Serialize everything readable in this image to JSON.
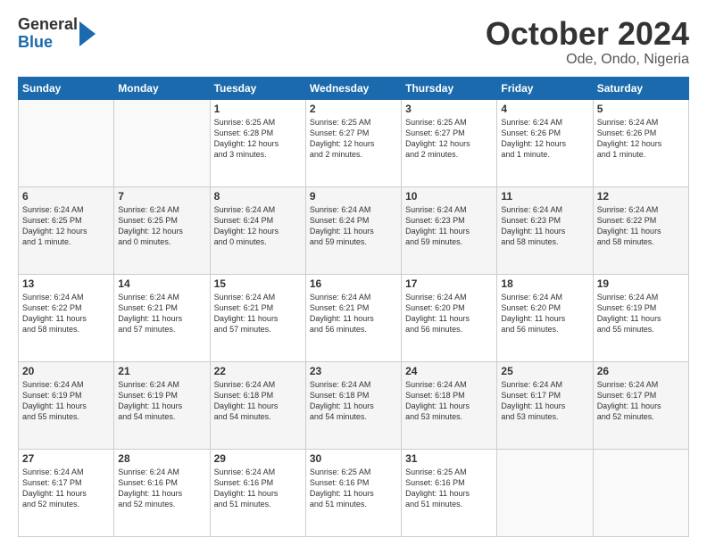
{
  "header": {
    "logo": {
      "general": "General",
      "blue": "Blue"
    },
    "title": "October 2024",
    "location": "Ode, Ondo, Nigeria"
  },
  "weekdays": [
    "Sunday",
    "Monday",
    "Tuesday",
    "Wednesday",
    "Thursday",
    "Friday",
    "Saturday"
  ],
  "weeks": [
    [
      {
        "day": "",
        "info": ""
      },
      {
        "day": "",
        "info": ""
      },
      {
        "day": "1",
        "info": "Sunrise: 6:25 AM\nSunset: 6:28 PM\nDaylight: 12 hours\nand 3 minutes."
      },
      {
        "day": "2",
        "info": "Sunrise: 6:25 AM\nSunset: 6:27 PM\nDaylight: 12 hours\nand 2 minutes."
      },
      {
        "day": "3",
        "info": "Sunrise: 6:25 AM\nSunset: 6:27 PM\nDaylight: 12 hours\nand 2 minutes."
      },
      {
        "day": "4",
        "info": "Sunrise: 6:24 AM\nSunset: 6:26 PM\nDaylight: 12 hours\nand 1 minute."
      },
      {
        "day": "5",
        "info": "Sunrise: 6:24 AM\nSunset: 6:26 PM\nDaylight: 12 hours\nand 1 minute."
      }
    ],
    [
      {
        "day": "6",
        "info": "Sunrise: 6:24 AM\nSunset: 6:25 PM\nDaylight: 12 hours\nand 1 minute."
      },
      {
        "day": "7",
        "info": "Sunrise: 6:24 AM\nSunset: 6:25 PM\nDaylight: 12 hours\nand 0 minutes."
      },
      {
        "day": "8",
        "info": "Sunrise: 6:24 AM\nSunset: 6:24 PM\nDaylight: 12 hours\nand 0 minutes."
      },
      {
        "day": "9",
        "info": "Sunrise: 6:24 AM\nSunset: 6:24 PM\nDaylight: 11 hours\nand 59 minutes."
      },
      {
        "day": "10",
        "info": "Sunrise: 6:24 AM\nSunset: 6:23 PM\nDaylight: 11 hours\nand 59 minutes."
      },
      {
        "day": "11",
        "info": "Sunrise: 6:24 AM\nSunset: 6:23 PM\nDaylight: 11 hours\nand 58 minutes."
      },
      {
        "day": "12",
        "info": "Sunrise: 6:24 AM\nSunset: 6:22 PM\nDaylight: 11 hours\nand 58 minutes."
      }
    ],
    [
      {
        "day": "13",
        "info": "Sunrise: 6:24 AM\nSunset: 6:22 PM\nDaylight: 11 hours\nand 58 minutes."
      },
      {
        "day": "14",
        "info": "Sunrise: 6:24 AM\nSunset: 6:21 PM\nDaylight: 11 hours\nand 57 minutes."
      },
      {
        "day": "15",
        "info": "Sunrise: 6:24 AM\nSunset: 6:21 PM\nDaylight: 11 hours\nand 57 minutes."
      },
      {
        "day": "16",
        "info": "Sunrise: 6:24 AM\nSunset: 6:21 PM\nDaylight: 11 hours\nand 56 minutes."
      },
      {
        "day": "17",
        "info": "Sunrise: 6:24 AM\nSunset: 6:20 PM\nDaylight: 11 hours\nand 56 minutes."
      },
      {
        "day": "18",
        "info": "Sunrise: 6:24 AM\nSunset: 6:20 PM\nDaylight: 11 hours\nand 56 minutes."
      },
      {
        "day": "19",
        "info": "Sunrise: 6:24 AM\nSunset: 6:19 PM\nDaylight: 11 hours\nand 55 minutes."
      }
    ],
    [
      {
        "day": "20",
        "info": "Sunrise: 6:24 AM\nSunset: 6:19 PM\nDaylight: 11 hours\nand 55 minutes."
      },
      {
        "day": "21",
        "info": "Sunrise: 6:24 AM\nSunset: 6:19 PM\nDaylight: 11 hours\nand 54 minutes."
      },
      {
        "day": "22",
        "info": "Sunrise: 6:24 AM\nSunset: 6:18 PM\nDaylight: 11 hours\nand 54 minutes."
      },
      {
        "day": "23",
        "info": "Sunrise: 6:24 AM\nSunset: 6:18 PM\nDaylight: 11 hours\nand 54 minutes."
      },
      {
        "day": "24",
        "info": "Sunrise: 6:24 AM\nSunset: 6:18 PM\nDaylight: 11 hours\nand 53 minutes."
      },
      {
        "day": "25",
        "info": "Sunrise: 6:24 AM\nSunset: 6:17 PM\nDaylight: 11 hours\nand 53 minutes."
      },
      {
        "day": "26",
        "info": "Sunrise: 6:24 AM\nSunset: 6:17 PM\nDaylight: 11 hours\nand 52 minutes."
      }
    ],
    [
      {
        "day": "27",
        "info": "Sunrise: 6:24 AM\nSunset: 6:17 PM\nDaylight: 11 hours\nand 52 minutes."
      },
      {
        "day": "28",
        "info": "Sunrise: 6:24 AM\nSunset: 6:16 PM\nDaylight: 11 hours\nand 52 minutes."
      },
      {
        "day": "29",
        "info": "Sunrise: 6:24 AM\nSunset: 6:16 PM\nDaylight: 11 hours\nand 51 minutes."
      },
      {
        "day": "30",
        "info": "Sunrise: 6:25 AM\nSunset: 6:16 PM\nDaylight: 11 hours\nand 51 minutes."
      },
      {
        "day": "31",
        "info": "Sunrise: 6:25 AM\nSunset: 6:16 PM\nDaylight: 11 hours\nand 51 minutes."
      },
      {
        "day": "",
        "info": ""
      },
      {
        "day": "",
        "info": ""
      }
    ]
  ]
}
